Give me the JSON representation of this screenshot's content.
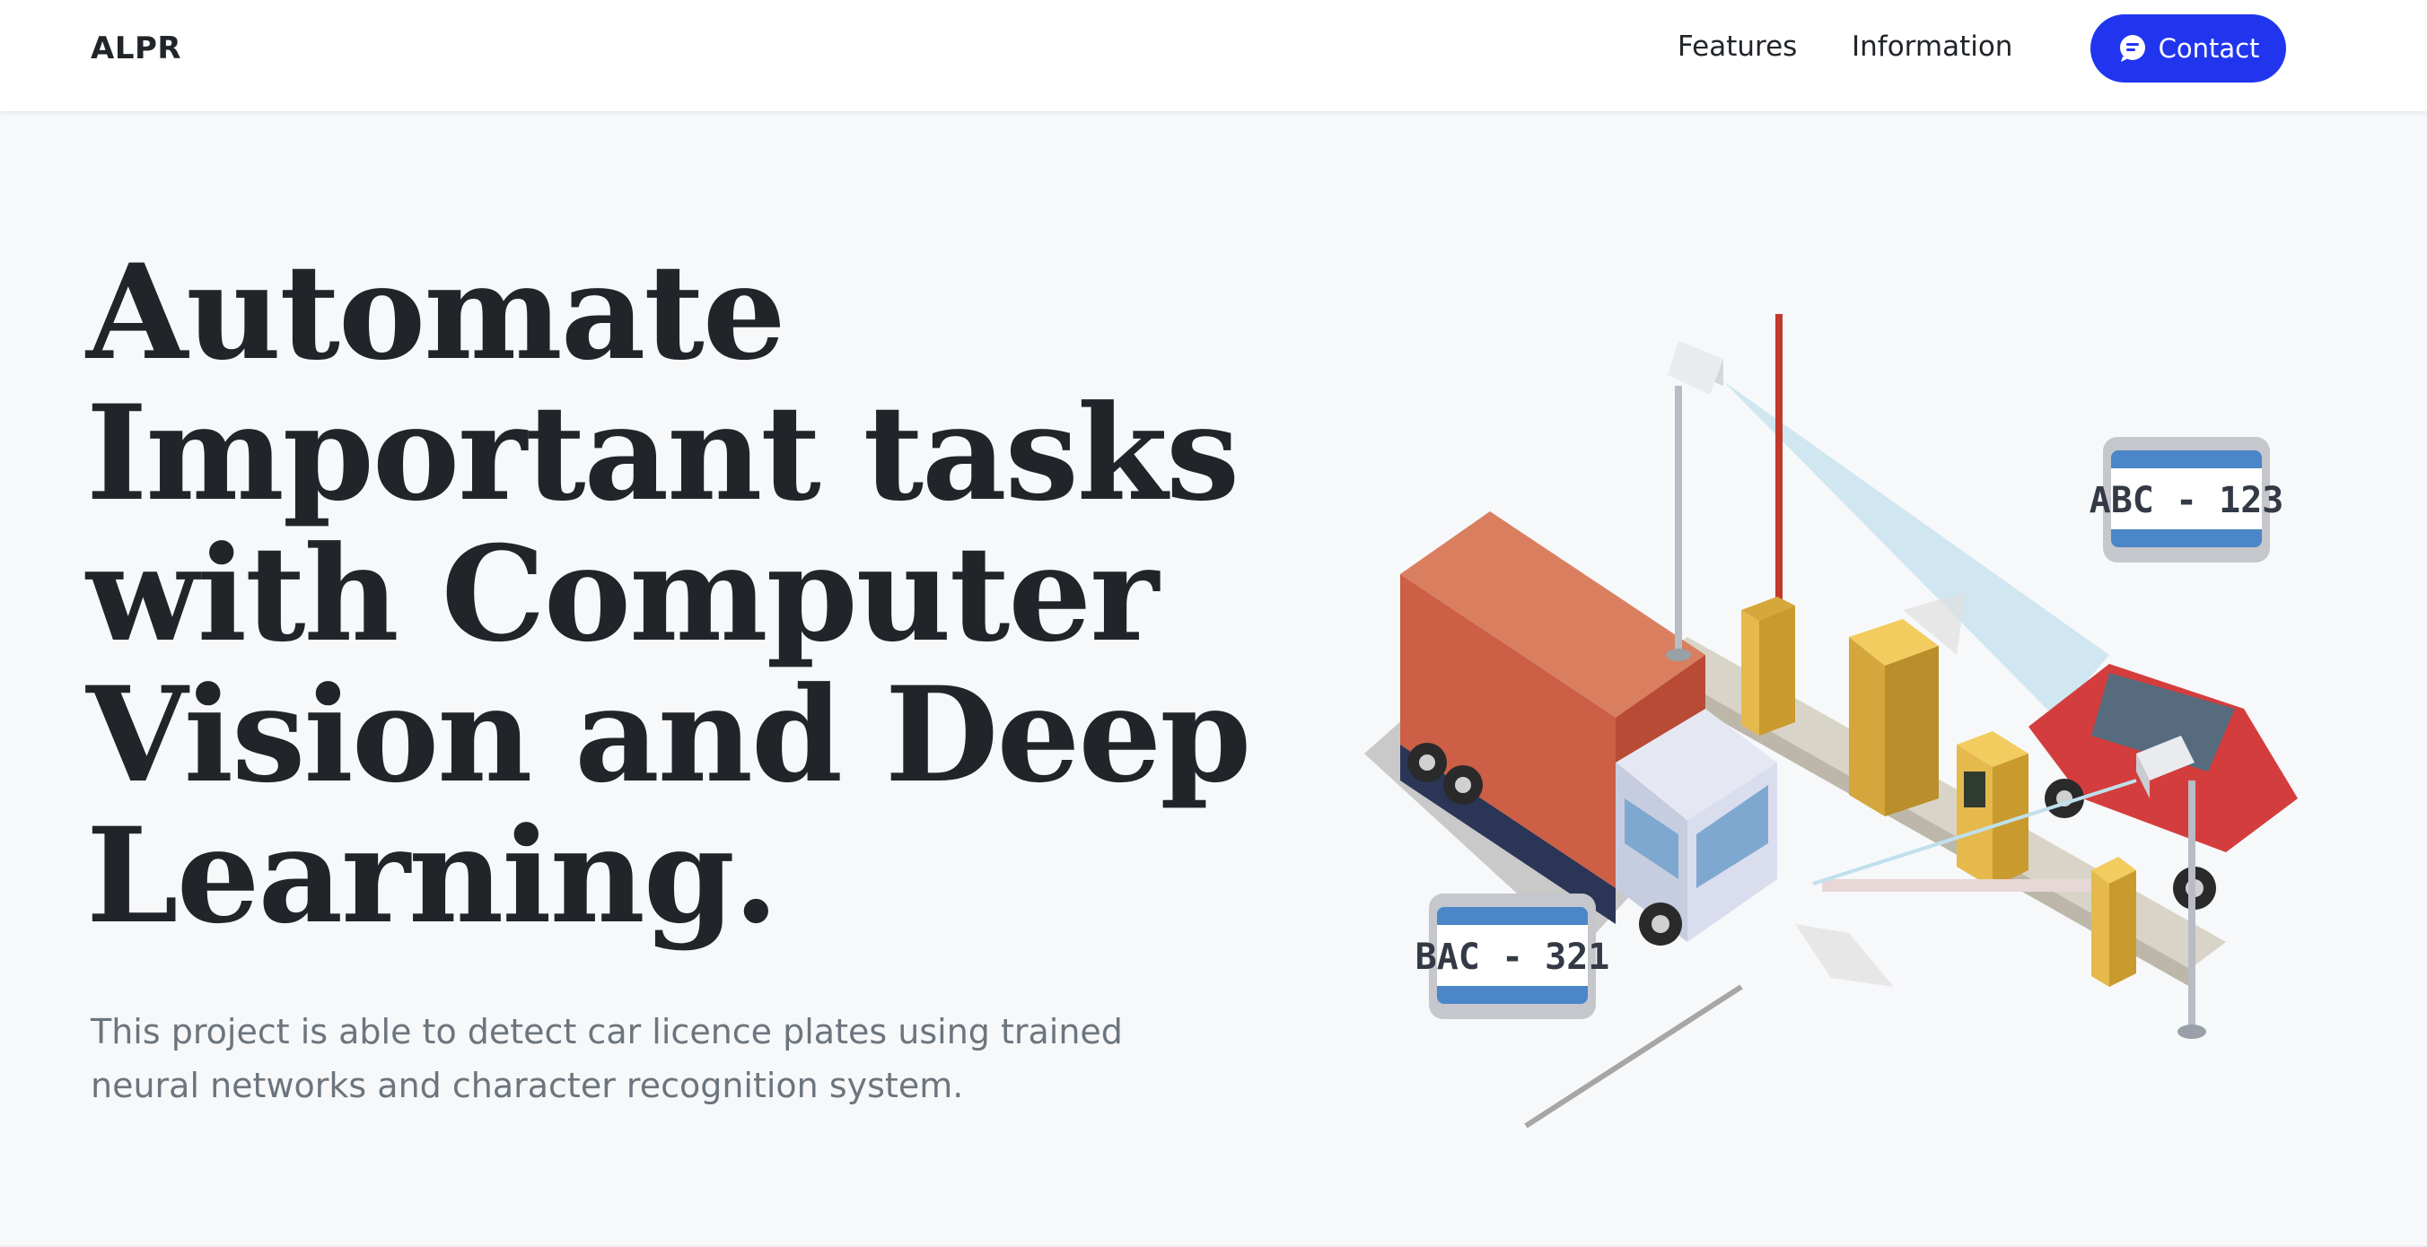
{
  "navbar": {
    "brand": "ALPR",
    "links": [
      {
        "label": "Features"
      },
      {
        "label": "Information"
      }
    ],
    "contact_label": "Contact",
    "contact_icon": "chat-bubble-icon",
    "accent_color": "#2135ef"
  },
  "hero": {
    "title": "Automate Important tasks with Computer Vision and Deep Learning.",
    "subtitle": "This project is able to detect car licence plates using trained neural networks and character recognition system."
  },
  "illustration": {
    "plates": [
      {
        "text": "ABC - 123"
      },
      {
        "text": "BAC - 321"
      }
    ]
  }
}
